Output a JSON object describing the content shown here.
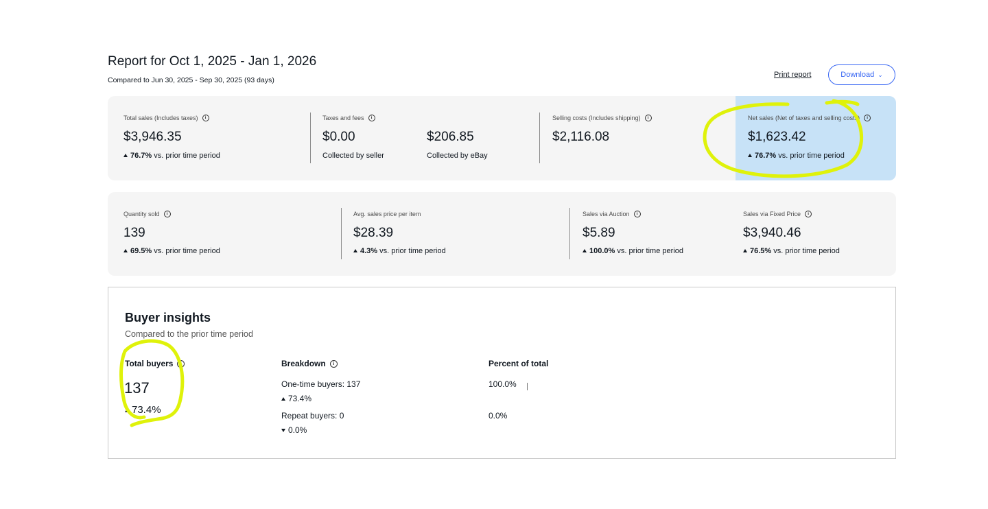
{
  "header": {
    "title": "Report for Oct 1, 2025 - Jan 1, 2026",
    "subtitle": "Compared to Jun 30, 2025 - Sep 30, 2025 (93 days)",
    "print_label": "Print report",
    "download_label": "Download"
  },
  "summary": {
    "total_sales": {
      "label": "Total sales (Includes taxes)",
      "value": "$3,946.35",
      "delta_pct": "76.7%",
      "delta_text": "vs. prior time period"
    },
    "taxes": {
      "label": "Taxes and fees",
      "seller_value": "$0.00",
      "seller_label": "Collected by seller",
      "ebay_value": "$206.85",
      "ebay_label": "Collected by eBay"
    },
    "selling_costs": {
      "label": "Selling costs (Includes shipping)",
      "value": "$2,116.08"
    },
    "net_sales": {
      "label": "Net sales (Net of taxes and selling costs)",
      "value": "$1,623.42",
      "delta_pct": "76.7%",
      "delta_text": "vs. prior time period"
    }
  },
  "quantity": {
    "qty_sold": {
      "label": "Quantity sold",
      "value": "139",
      "delta_pct": "69.5%",
      "delta_text": "vs. prior time period"
    },
    "avg_price": {
      "label": "Avg. sales price per item",
      "value": "$28.39",
      "delta_pct": "4.3%",
      "delta_text": "vs. prior time period"
    },
    "auction": {
      "label": "Sales via Auction",
      "value": "$5.89",
      "delta_pct": "100.0%",
      "delta_text": "vs. prior time period"
    },
    "fixed_price": {
      "label": "Sales via Fixed Price",
      "value": "$3,940.46",
      "delta_pct": "76.5%",
      "delta_text": "vs. prior time period"
    }
  },
  "buyer_insights": {
    "title": "Buyer insights",
    "subtitle": "Compared to the prior time period",
    "total_buyers_label": "Total buyers",
    "total_buyers_value": "137",
    "total_buyers_delta": "73.4%",
    "breakdown_label": "Breakdown",
    "percent_label": "Percent of total",
    "one_time": {
      "label": "One-time buyers: 137",
      "delta": "73.4%",
      "percent": "100.0%",
      "percent_fraction": 1.0
    },
    "repeat": {
      "label": "Repeat buyers: 0",
      "delta": "0.0%",
      "percent": "0.0%",
      "percent_fraction": 0.0
    }
  },
  "colors": {
    "accent": "#3665f3",
    "net_sales_highlight": "#c7e2f7",
    "panel_bg": "#f5f5f5",
    "annotation_marker": "#dff20a"
  },
  "icons": [
    "info-icon",
    "chevron-down-icon",
    "triangle-up-icon",
    "triangle-down-icon"
  ]
}
